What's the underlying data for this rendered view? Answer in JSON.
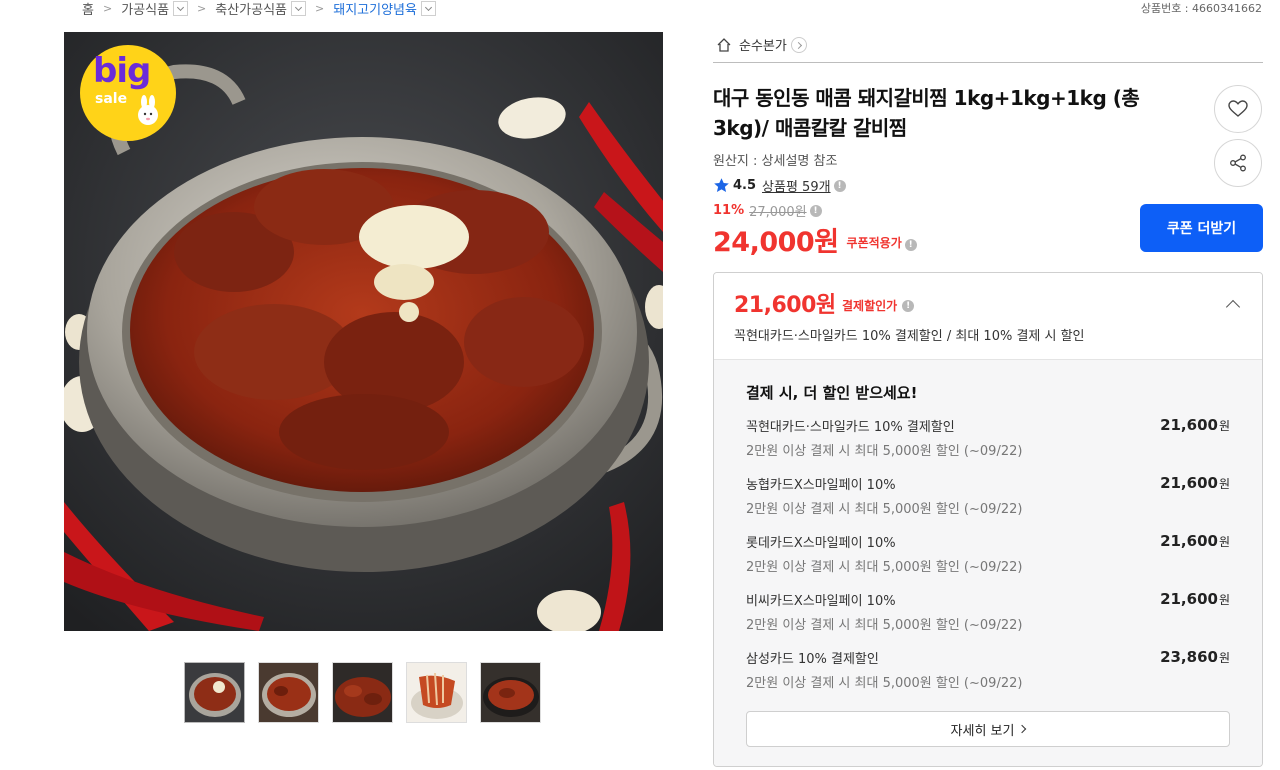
{
  "breadcrumb": {
    "items": [
      "홈",
      "가공식품",
      "축산가공식품",
      "돼지고기양념육"
    ],
    "product_no": "상품번호 : 4660341662"
  },
  "badge": {
    "big": "big",
    "sale": "sale"
  },
  "store": {
    "name": "순수본가"
  },
  "product": {
    "title": "대구 동인동 매콤 돼지갈비찜 1kg+1kg+1kg (총 3kg)/ 매콤칼칼 갈비찜",
    "origin": "원산지 : 상세설명 참조",
    "rating": "4.5",
    "reviews": "상품평 59개",
    "discount_rate": "11%",
    "original_price": "27,000원",
    "price": "24,000원",
    "coupon_note": "쿠폰적용가",
    "coupon_button": "쿠폰 더받기"
  },
  "payment": {
    "price": "21,600원",
    "label": "결제할인가",
    "desc": "꼭현대카드·스마일카드 10% 결제할인 / 최대 10% 결제 시 할인",
    "heading": "결제 시, 더 할인 받으세요!",
    "cards": [
      {
        "name": "꼭현대카드·스마일카드 10% 결제할인",
        "sub": "2만원 이상 결제 시 최대 5,000원 할인 (~09/22)",
        "amount": "21,600",
        "unit": "원"
      },
      {
        "name": "농협카드X스마일페이 10%",
        "sub": "2만원 이상 결제 시 최대 5,000원 할인 (~09/22)",
        "amount": "21,600",
        "unit": "원"
      },
      {
        "name": "롯데카드X스마일페이 10%",
        "sub": "2만원 이상 결제 시 최대 5,000원 할인 (~09/22)",
        "amount": "21,600",
        "unit": "원"
      },
      {
        "name": "비씨카드X스마일페이 10%",
        "sub": "2만원 이상 결제 시 최대 5,000원 할인 (~09/22)",
        "amount": "21,600",
        "unit": "원"
      },
      {
        "name": "삼성카드 10% 결제할인",
        "sub": "2만원 이상 결제 시 최대 5,000원 할인 (~09/22)",
        "amount": "23,860",
        "unit": "원"
      }
    ],
    "detail_button": "자세히 보기"
  },
  "colors": {
    "accent_red": "#f0342f",
    "button_blue": "#0d5ff7",
    "link_blue": "#1e6fd9",
    "badge_yellow": "#ffd318"
  }
}
